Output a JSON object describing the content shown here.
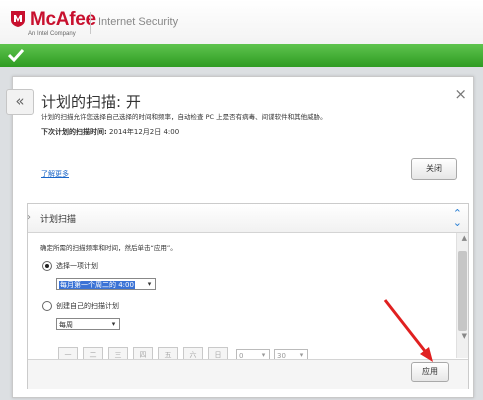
{
  "header": {
    "brand": "McAfee",
    "tagline": "An Intel Company",
    "product": "Internet Security"
  },
  "dialog": {
    "back_glyph": "«",
    "close_glyph": "×",
    "title": "计划的扫描: 开",
    "description": "计划的扫描允许您选择自己选择的时间和频率，自动检查 PC 上是否有病毒、间谍软件和其他威胁。",
    "next_label": "下次计划的扫描时间:",
    "next_value": "2014年12月2日 4:00",
    "learn_more": "了解更多",
    "close_button": "关闭"
  },
  "schedule": {
    "section_title": "计划扫描",
    "instruction": "确定所需的扫描频率和时间，然后单击“应用”。",
    "option_preset": "选择一项计划",
    "preset_value": "每月第一个周二的 4:00",
    "option_custom": "创建自己的扫描计划",
    "frequency_value": "每周",
    "days": [
      "一",
      "二",
      "三",
      "四",
      "五",
      "六",
      "日"
    ],
    "hour_value": "0",
    "minute_value": "30",
    "apply_button": "应用"
  },
  "colors": {
    "brand_red": "#c8102e",
    "status_green": "#3aa82c",
    "link_blue": "#1a66c8",
    "annotation_red": "#e02020"
  },
  "icons": {
    "status": "checkmark-icon",
    "back": "double-chevron-left-icon",
    "close": "close-icon",
    "collapse": "collapse-chevrons-icon"
  }
}
